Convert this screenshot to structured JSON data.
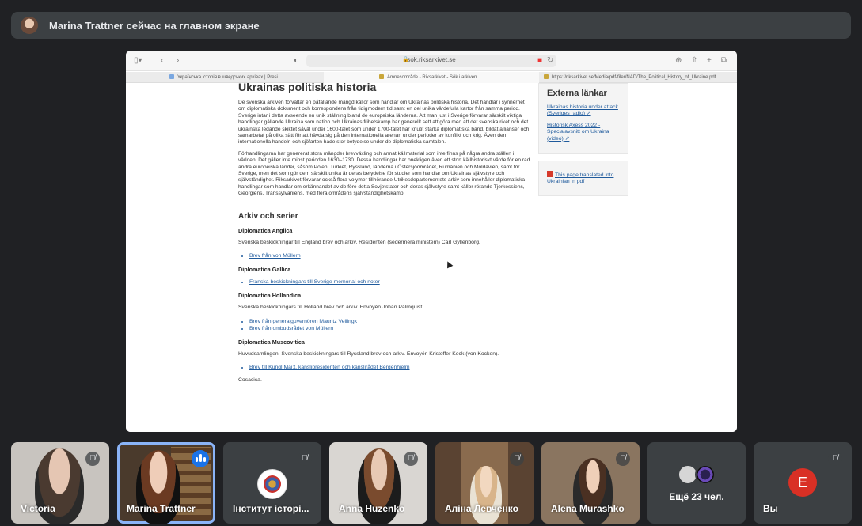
{
  "banner": {
    "text": "Marina Trattner сейчас на главном экране",
    "avatar_icon": "presenter-avatar"
  },
  "browser": {
    "url": "sok.riksarkivet.se",
    "tabs": [
      {
        "label": "Українська історія в шведських архівах | Presi",
        "active": false
      },
      {
        "label": "Ämnesområde - Riksarkivet - Sök i arkiven",
        "active": true
      },
      {
        "label": "https://riksarkivet.se/Media/pdf-filer/NAD/The_Political_History_of_Ukraine.pdf",
        "active": false
      }
    ]
  },
  "page": {
    "title": "Ukrainas politiska historia",
    "paragraphs": [
      "De svenska arkiven förvaltar en påfallande mängd källor som handlar om Ukrainas politiska historia. Det handlar i synnerhet om diplomatiska dokument och korrespondens från tidigmodern tid samt en del unika värdefulla kartor från samma period. Sverige intar i detta avseende en unik ställning bland de europeiska länderna. Att man just i Sverige förvarar särskilt viktiga handlingar gällande Ukraina som nation och Ukrainas frihetskamp har generellt sett att göra med att det svenska riket och det ukrainska ledande skiktet såväl under 1600-talet som under 1700-talet har knutit starka diplomatiska band, bildat allianser och samarbetat på olika sätt för att hävda sig på den internationella arenan under perioder av konflikt och krig. Även den internationella handeln och sjöfarten hade stor betydelse under de diplomatiska samtalen.",
      "Förhandlingarna har genererat stora mängder brevväxling och annat källmaterial som inte finns på några andra ställen i världen. Det gäller inte minst perioden 1630–1730. Dessa handlingar har onekligen även ett stort källhistoriskt värde för en rad andra europeiska länder, såsom Polen, Turkiet, Ryssland, länderna i Östersjöområdet, Rumänien och Moldavien, samt för Sverige, men det som gör dem särskilt unika är deras betydelse för studier som handlar om Ukrainas självstyre och självständighet. Riksarkivet förvarar också flera volymer tillhörande Utrikesdepartementets arkiv som innehåller diplomatiska handlingar som handlar om erkännandet av de före detta Sovjetstater och deras självstyre samt källor rörande Tjerkessiens, Georgiens, Transsylvaniens, med flera områdens självständighetskamp."
    ],
    "section_title": "Arkiv och serier",
    "series": [
      {
        "title": "Diplomatica Anglica",
        "desc": "Svenska beskickningar till England brev och arkiv. Residenten (sedermera ministern) Carl Gyllenborg.",
        "links": [
          "Brev från von Müllern"
        ]
      },
      {
        "title": "Diplomatica Gallica",
        "desc": "",
        "links": [
          "Franska beskickningars till Sverige memorial och noter"
        ]
      },
      {
        "title": "Diplomatica Hollandica",
        "desc": "Svenska beskickningars till Holland brev och arkiv. Envoyén Johan Palmquist.",
        "links": [
          "Brev från generalguvernören Mauritz Vellingk",
          "Brev från ombudsrådet von Müllern"
        ]
      },
      {
        "title": "Diplomatica Muscovitica",
        "desc": "Huvudsamlingen, Svenska beskickningars till Ryssland brev och arkiv. Envoyén Kristoffer Kock (von Kocken).",
        "links": [
          "Brev till Kungl Maj:t, kanslipresidenten och kanslirådet Bergenhielm"
        ]
      }
    ],
    "trailing": "Cosacica."
  },
  "sidebar": {
    "title": "Externa länkar",
    "links": [
      "Ukrainas historia under attack (Sveriges radio)",
      "Historisk Axess 2022 - Specialavsnitt om Ukraina (video)"
    ],
    "pdf_link": "This page translated into Ukrainian in pdf"
  },
  "participants": [
    {
      "name": "Victoria",
      "muted": true
    },
    {
      "name": "Marina Trattner",
      "muted": false,
      "speaking": true
    },
    {
      "name": "Інститут історі...",
      "muted": true
    },
    {
      "name": "Anna Huzenko",
      "muted": true
    },
    {
      "name": "Аліна Левченко",
      "muted": true
    },
    {
      "name": "Alena Murashko",
      "muted": true
    },
    {
      "name": "Ещё 23 чел.",
      "muted": false
    },
    {
      "name": "Вы",
      "muted": true,
      "initial": "E"
    }
  ],
  "colors": {
    "meet_bg": "#202124",
    "tile_bg": "#3c4043",
    "link": "#1f5a9c",
    "speaking_outline": "#8ab4f8",
    "self_avatar": "#d93025"
  }
}
